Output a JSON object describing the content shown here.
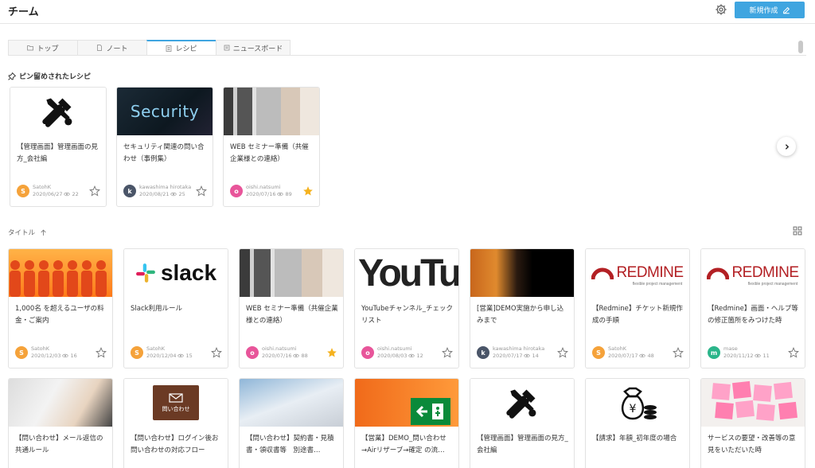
{
  "header": {
    "title": "チーム",
    "new_button": "新規作成"
  },
  "tabs": [
    {
      "label": "トップ",
      "icon": "folder-icon",
      "active": false
    },
    {
      "label": "ノート",
      "icon": "note-icon",
      "active": false
    },
    {
      "label": "レシピ",
      "icon": "recipe-icon",
      "active": true
    },
    {
      "label": "ニュースボード",
      "icon": "news-icon",
      "active": false
    }
  ],
  "pinned": {
    "title": "ピン留めされたレシピ",
    "cards": [
      {
        "title": "【管理画面】管理画面の見方_会社編",
        "thumb": "tools",
        "author": "SatohK",
        "initial": "S",
        "avatar_color": "#f5a23a",
        "date": "2020/06/27",
        "views": "22",
        "starred": false
      },
      {
        "title": "セキュリティ関連の問い合わせ（事例集）",
        "thumb": "security",
        "thumb_text": "Security",
        "author": "kawashima hirotaka",
        "initial": "k",
        "avatar_color": "#4a5568",
        "date": "2020/08/21",
        "views": "25",
        "starred": false
      },
      {
        "title": "WEB セミナー準備（共催企業様との連絡）",
        "thumb": "office",
        "author": "oishi.natsumi",
        "initial": "o",
        "avatar_color": "#e8559a",
        "date": "2020/07/16",
        "views": "89",
        "starred": true
      }
    ]
  },
  "list": {
    "sort_label": "タイトル",
    "rows": [
      [
        {
          "title": "1,000名 を超えるユーザの料金・ご案内",
          "thumb": "people",
          "author": "SatohK",
          "initial": "S",
          "avatar_color": "#f5a23a",
          "date": "2020/12/03",
          "views": "16",
          "starred": false
        },
        {
          "title": "Slack利用ルール",
          "thumb": "slack",
          "thumb_text": "slack",
          "author": "SatohK",
          "initial": "S",
          "avatar_color": "#f5a23a",
          "date": "2020/12/04",
          "views": "15",
          "starred": false
        },
        {
          "title": "WEB セミナー準備（共催企業様との連絡）",
          "thumb": "office",
          "author": "oishi.natsumi",
          "initial": "o",
          "avatar_color": "#e8559a",
          "date": "2020/07/16",
          "views": "88",
          "starred": true
        },
        {
          "title": "YouTubeチャンネル_チェックリスト",
          "thumb": "youtube",
          "thumb_text": "YouTu",
          "author": "oishi.natsumi",
          "initial": "o",
          "avatar_color": "#e8559a",
          "date": "2020/08/03",
          "views": "12",
          "starred": false
        },
        {
          "title": "[営業]DEMO実施から申し込みまで",
          "thumb": "tiger",
          "author": "kawashima hirotaka",
          "initial": "k",
          "avatar_color": "#4a5568",
          "date": "2020/07/17",
          "views": "14",
          "starred": false
        },
        {
          "title": "【Redmine】チケット新規作成の手順",
          "thumb": "redmine",
          "thumb_text": "REDMINE",
          "thumb_sub": "flexible project management",
          "author": "SatohK",
          "initial": "S",
          "avatar_color": "#f5a23a",
          "date": "2020/07/17",
          "views": "48",
          "starred": false
        },
        {
          "title": "【Redmine】画面・ヘルプ等の修正箇所をみつけた時",
          "thumb": "redmine",
          "thumb_text": "REDMINE",
          "thumb_sub": "flexible project management",
          "author": "mase",
          "initial": "m",
          "avatar_color": "#2bb58a",
          "date": "2020/11/12",
          "views": "11",
          "starred": false
        }
      ],
      [
        {
          "title": "【問い合わせ】メール返信の共通ルール",
          "thumb": "writing"
        },
        {
          "title": "【問い合わせ】ログイン後お問い合わせの対応フロー",
          "thumb": "contact",
          "thumb_text": "問い合わせ"
        },
        {
          "title": "【問い合わせ】契約書・見積書・領収書等　別途書…",
          "thumb": "laptop"
        },
        {
          "title": "【営業】DEMO_問い合わせ→Airリザーブ→確定 の流…",
          "thumb": "exit"
        },
        {
          "title": "【管理画面】管理画面の見方_会社編",
          "thumb": "tools"
        },
        {
          "title": "【請求】年額_初年度の場合",
          "thumb": "money"
        },
        {
          "title": "サービスの要望・改善等の意見をいただいた時",
          "thumb": "sticky"
        }
      ]
    ]
  }
}
